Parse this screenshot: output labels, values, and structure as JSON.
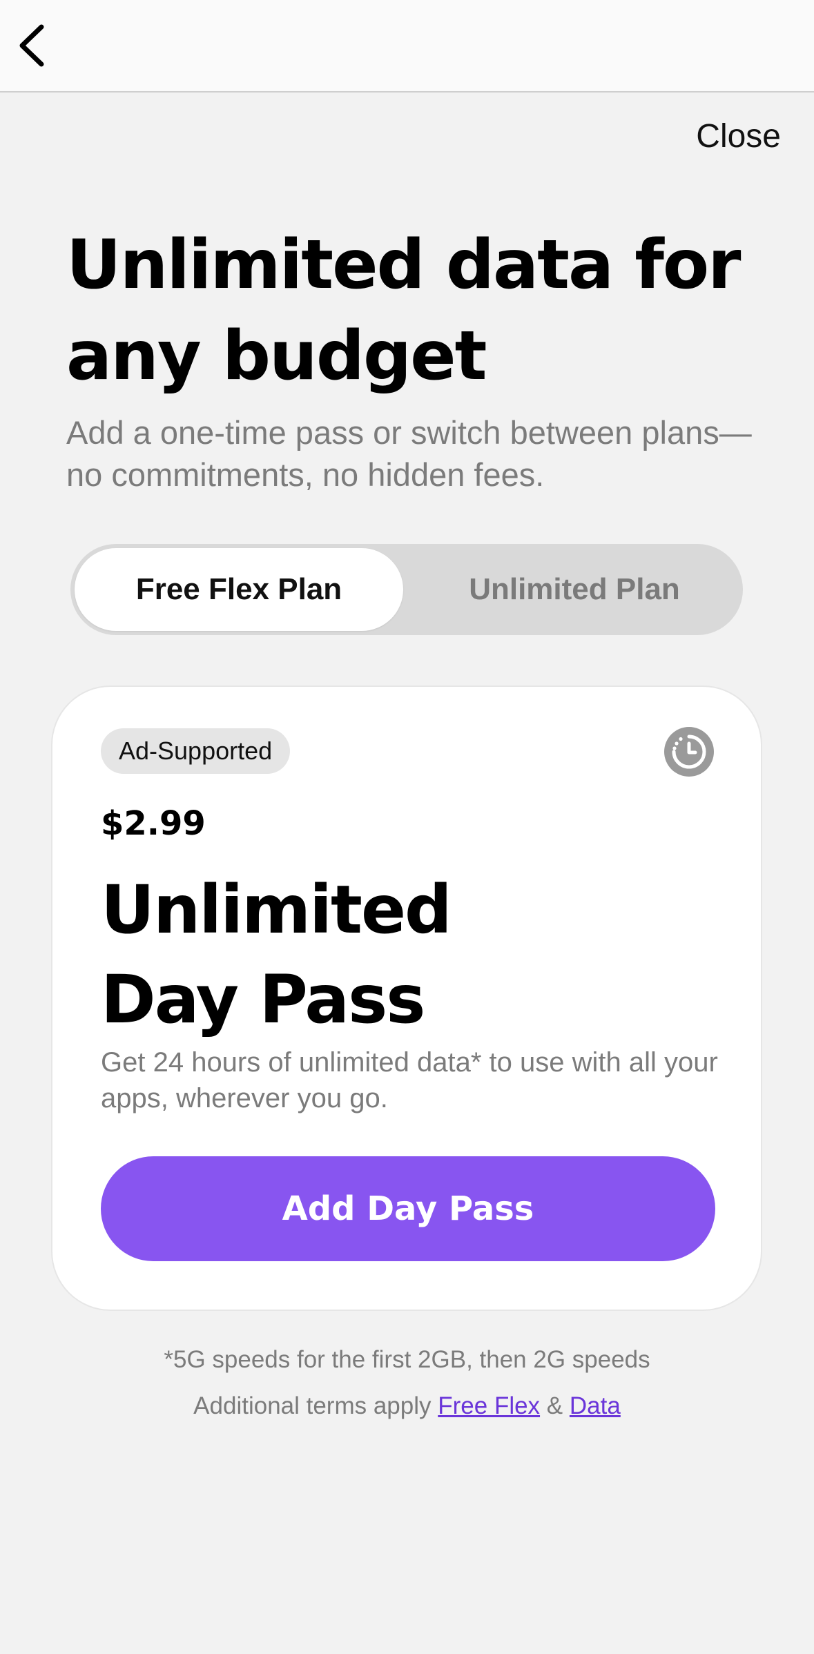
{
  "header": {
    "back_icon": "chevron-left-icon",
    "close_label": "Close"
  },
  "hero": {
    "title": "Unlimited data for any budget",
    "subtitle": "Add a one-time pass or switch between plans—no commitments, no hidden fees."
  },
  "plan_toggle": {
    "options": [
      {
        "label": "Free Flex Plan",
        "selected": true
      },
      {
        "label": "Unlimited Plan",
        "selected": false
      }
    ]
  },
  "offer_card": {
    "badge": "Ad-Supported",
    "icon": "timer-icon",
    "price": "$2.99",
    "title_line1": "Unlimited",
    "title_line2": "Day Pass",
    "description": "Get 24 hours of unlimited data* to use with all your apps, wherever you go.",
    "cta_label": "Add Day Pass"
  },
  "footer": {
    "speed_note": "*5G speeds for the first 2GB, then 2G speeds",
    "terms_prefix": "Additional terms apply",
    "link_free_flex": "Free Flex",
    "ampersand": "&",
    "link_data": "Data"
  },
  "colors": {
    "accent": "#8855f0",
    "link": "#6a35d9",
    "background": "#f2f2f2",
    "card": "#ffffff",
    "muted_text": "#7b7b7b"
  }
}
